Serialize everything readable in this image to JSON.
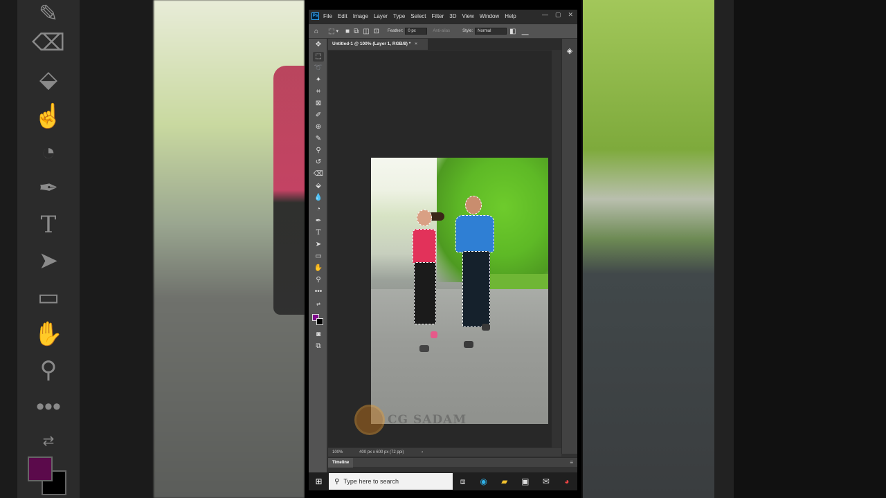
{
  "menu": {
    "logo": "Ps",
    "items": [
      "File",
      "Edit",
      "Image",
      "Layer",
      "Type",
      "Select",
      "Filter",
      "3D",
      "View",
      "Window",
      "Help"
    ]
  },
  "options": {
    "feather_label": "Feather:",
    "feather_value": "0 px",
    "antialias_label": "Anti-alias",
    "style_label": "Style:",
    "style_value": "Normal"
  },
  "document": {
    "tab_title": "Untitled-1 @ 100% (Layer 1, RGB/8) *"
  },
  "status": {
    "zoom": "100%",
    "doc_info": "400 px x 600 px (72 ppi)"
  },
  "timeline": {
    "tab_label": "Timeline"
  },
  "watermark": {
    "text": "CG SADAM"
  },
  "taskbar": {
    "search_placeholder": "Type here to search"
  },
  "colors": {
    "foreground": "#7f0c8c",
    "background": "#000000"
  }
}
